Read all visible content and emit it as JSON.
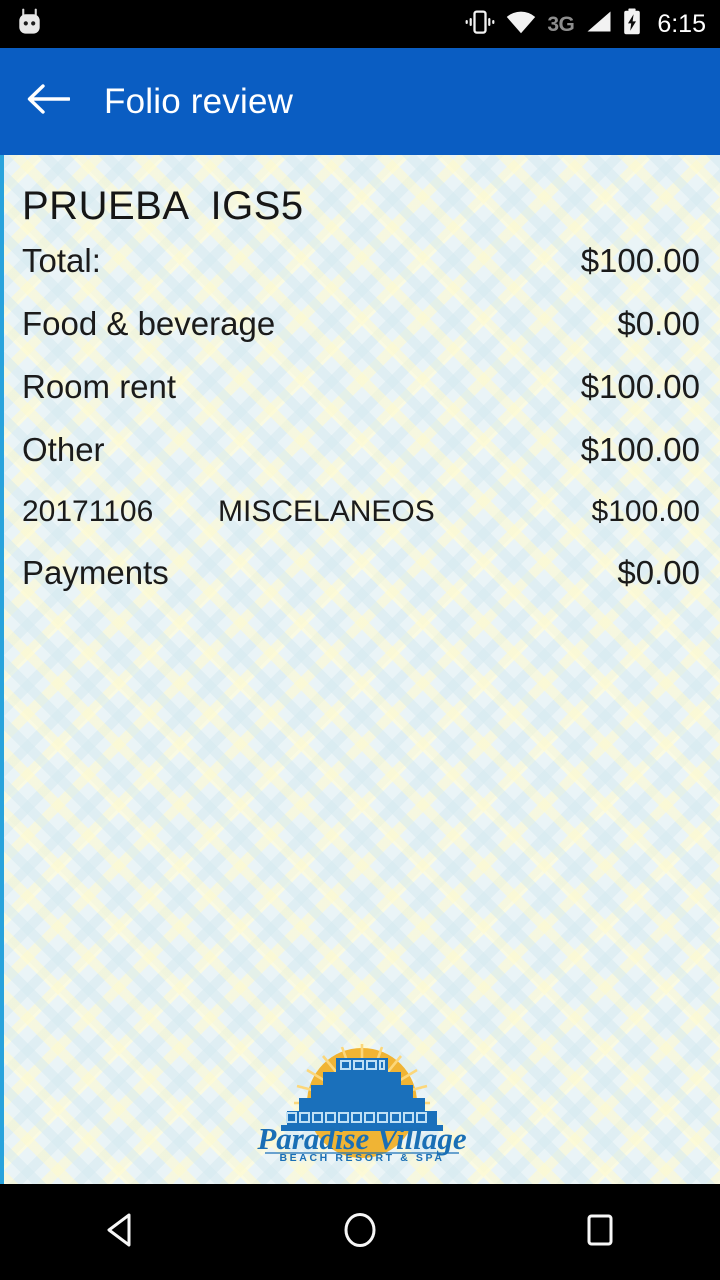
{
  "statusbar": {
    "mascot_icon": "android-mascot-icon",
    "vibrate_icon": "vibrate-icon",
    "wifi_icon": "wifi-icon",
    "network_label": "3G",
    "signal_icon": "signal-bars-icon",
    "battery_icon": "battery-charging-icon",
    "time": "6:15"
  },
  "appbar": {
    "back_icon": "back-arrow-icon",
    "title": "Folio review",
    "background_color": "#0A5DC2"
  },
  "folio": {
    "guest_name": "PRUEBA  IGS5",
    "total_row": {
      "label": "Total:",
      "amount": "$100.00"
    },
    "categories": [
      {
        "label": "Food & beverage",
        "amount": "$0.00"
      },
      {
        "label": "Room rent",
        "amount": "$100.00"
      }
    ],
    "other_row": {
      "label": "Other",
      "amount": "$100.00"
    },
    "detail_rows": [
      {
        "date": "20171106",
        "description": "MISCELANEOS",
        "amount": "$100.00"
      }
    ],
    "payments_row": {
      "label": "Payments",
      "amount": "$0.00"
    }
  },
  "logo": {
    "name": "Paradise Village",
    "tagline": "BEACH RESORT & SPA",
    "sun_color": "#F0B434",
    "pyramid_color": "#1A70BB",
    "text_color": "#1A6FB5"
  },
  "navbar": {
    "back_icon": "nav-back-triangle-icon",
    "home_icon": "nav-home-circle-icon",
    "recents_icon": "nav-recents-square-icon"
  }
}
